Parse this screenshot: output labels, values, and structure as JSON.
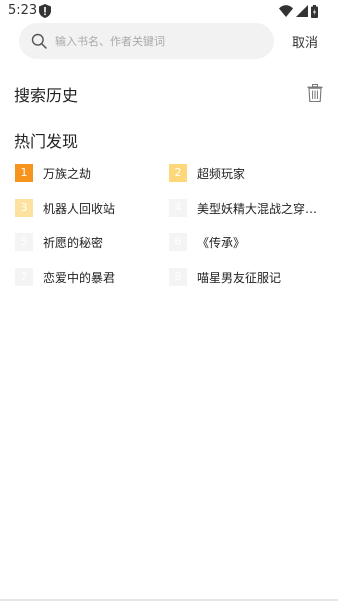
{
  "status_bar": {
    "time": "5:23"
  },
  "search": {
    "placeholder": "输入书名、作者关键词",
    "cancel_label": "取消"
  },
  "history": {
    "title": "搜索历史"
  },
  "hot": {
    "title": "热门发现",
    "items": [
      {
        "rank": "1",
        "name": "万族之劫"
      },
      {
        "rank": "2",
        "name": "超频玩家"
      },
      {
        "rank": "3",
        "name": "机器人回收站"
      },
      {
        "rank": "4",
        "name": "美型妖精大混战之穿…"
      },
      {
        "rank": "5",
        "name": "祈愿的秘密"
      },
      {
        "rank": "6",
        "name": "《传承》"
      },
      {
        "rank": "7",
        "name": "恋爱中的暴君"
      },
      {
        "rank": "8",
        "name": "喵星男友征服记"
      }
    ]
  },
  "colors": {
    "rank_1": "#f7941d",
    "rank_2": "#fdd77a",
    "rank_3": "#fde19f",
    "rank_rest": "#f4f4f4"
  }
}
